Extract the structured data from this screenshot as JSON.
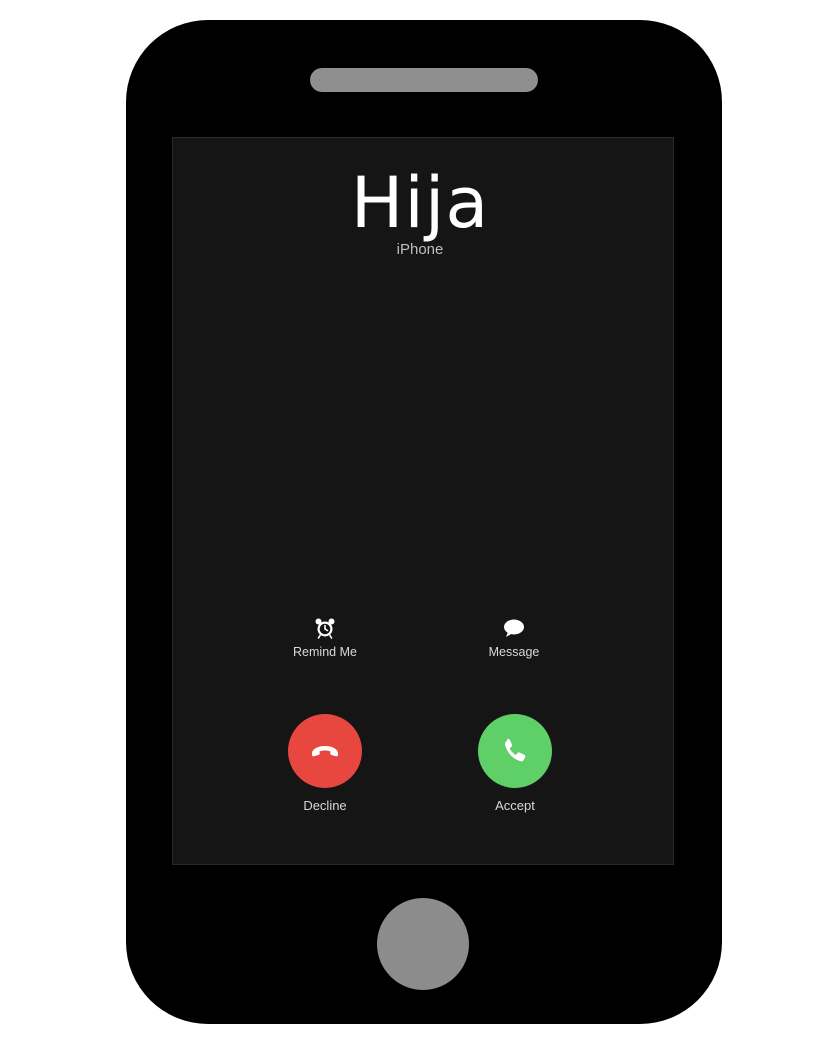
{
  "call": {
    "caller_name": "Hija",
    "caller_subtitle": "iPhone"
  },
  "quick_actions": {
    "remind_label": "Remind Me",
    "message_label": "Message"
  },
  "buttons": {
    "decline_label": "Decline",
    "accept_label": "Accept"
  },
  "colors": {
    "phone_body": "#000000",
    "screen_bg": "#151516",
    "decline": "#e8473f",
    "accept": "#5fcf67",
    "speaker_and_home": "#8c8c8c"
  },
  "icons": {
    "remind": "alarm-clock-icon",
    "message": "speech-bubble-icon",
    "decline": "phone-hangup-icon",
    "accept": "phone-icon"
  }
}
